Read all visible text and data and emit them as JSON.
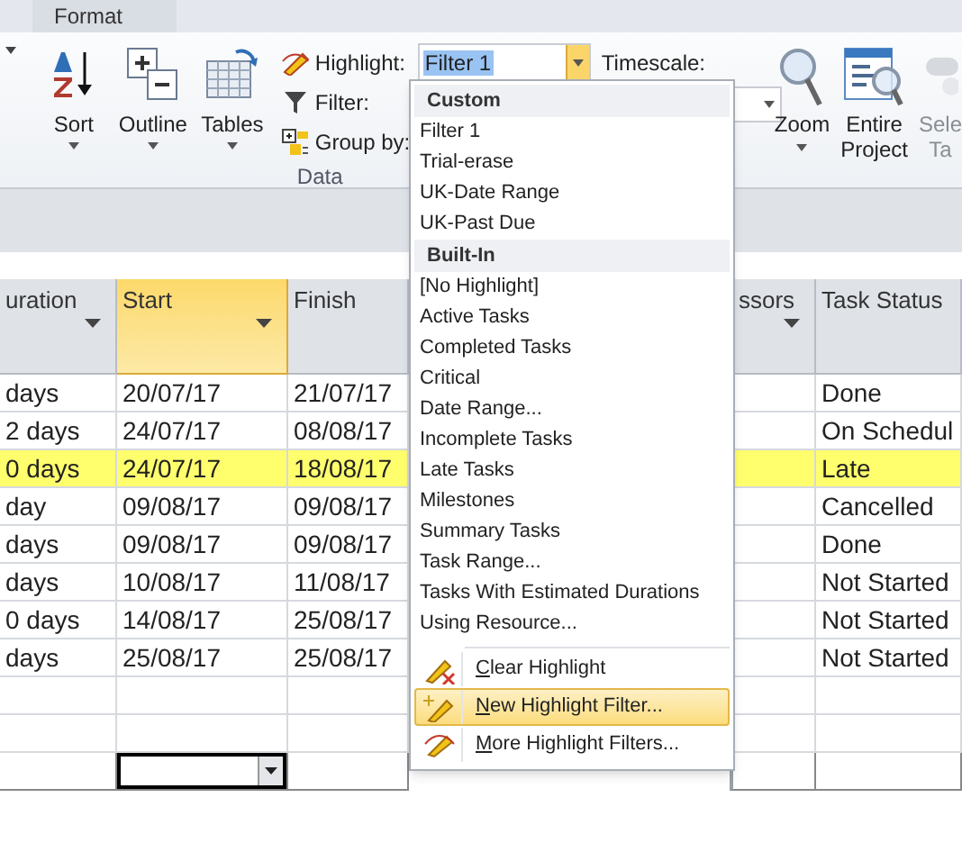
{
  "ribbon": {
    "tab_label": "Format",
    "data_buttons": [
      {
        "kind": "sort",
        "label": "Sort"
      },
      {
        "kind": "outline",
        "label": "Outline"
      },
      {
        "kind": "tables",
        "label": "Tables"
      }
    ],
    "highlight": {
      "label": "Highlight:",
      "value": "Filter 1"
    },
    "filter": {
      "label": "Filter:"
    },
    "group_by": {
      "label": "Group by:"
    },
    "group_label": "Data",
    "timescale": {
      "label": "Timescale:"
    },
    "view_buttons": [
      {
        "kind": "zoom",
        "lines": [
          "Zoom"
        ],
        "caret": true,
        "disabled": false
      },
      {
        "kind": "entire",
        "lines": [
          "Entire",
          "Project"
        ],
        "caret": false,
        "disabled": false
      },
      {
        "kind": "selected",
        "lines": [
          "Sele",
          "Ta"
        ],
        "caret": false,
        "disabled": true
      }
    ]
  },
  "table": {
    "columns": [
      {
        "label": "uration",
        "filter_arrow": true,
        "selected": false
      },
      {
        "label": "Start",
        "filter_arrow": true,
        "selected": true
      },
      {
        "label": "Finish",
        "filter_arrow": false,
        "selected": false
      },
      {
        "label": "ssors",
        "filter_arrow": true,
        "selected": false
      },
      {
        "label": "Task Status",
        "filter_arrow": false,
        "selected": false
      }
    ],
    "rows": [
      {
        "highlighted": false,
        "cells": [
          "days",
          "20/07/17",
          "21/07/17",
          "",
          "Done"
        ]
      },
      {
        "highlighted": false,
        "cells": [
          "2 days",
          "24/07/17",
          "08/08/17",
          "",
          "On Schedul"
        ]
      },
      {
        "highlighted": true,
        "cells": [
          "0 days",
          "24/07/17",
          "18/08/17",
          "",
          "Late"
        ]
      },
      {
        "highlighted": false,
        "cells": [
          "day",
          "09/08/17",
          "09/08/17",
          "",
          "Cancelled"
        ]
      },
      {
        "highlighted": false,
        "cells": [
          "days",
          "09/08/17",
          "09/08/17",
          "",
          "Done"
        ]
      },
      {
        "highlighted": false,
        "cells": [
          "days",
          "10/08/17",
          "11/08/17",
          "",
          "Not Started"
        ]
      },
      {
        "highlighted": false,
        "cells": [
          "0 days",
          "14/08/17",
          "25/08/17",
          "",
          "Not Started"
        ]
      },
      {
        "highlighted": false,
        "cells": [
          "days",
          "25/08/17",
          "25/08/17",
          "",
          "Not Started"
        ]
      }
    ],
    "empty_rows": [
      {
        "editing": false
      },
      {
        "editing": false
      },
      {
        "editing": true
      }
    ]
  },
  "highlight_menu": {
    "sections": [
      {
        "heading": "Custom",
        "items": [
          "Filter 1",
          "Trial-erase",
          "UK-Date Range",
          "UK-Past Due"
        ]
      },
      {
        "heading": "Built-In",
        "items": [
          "[No Highlight]",
          "Active Tasks",
          "Completed Tasks",
          "Critical",
          "Date Range...",
          "Incomplete Tasks",
          "Late Tasks",
          "Milestones",
          "Summary Tasks",
          "Task Range...",
          "Tasks With Estimated Durations",
          "Using Resource..."
        ]
      }
    ],
    "actions": [
      {
        "kind": "clear",
        "label": "Clear Highlight",
        "selected": false
      },
      {
        "kind": "new",
        "label": "New Highlight Filter...",
        "selected": true
      },
      {
        "kind": "more",
        "label": "More Highlight Filters...",
        "selected": false
      }
    ]
  }
}
